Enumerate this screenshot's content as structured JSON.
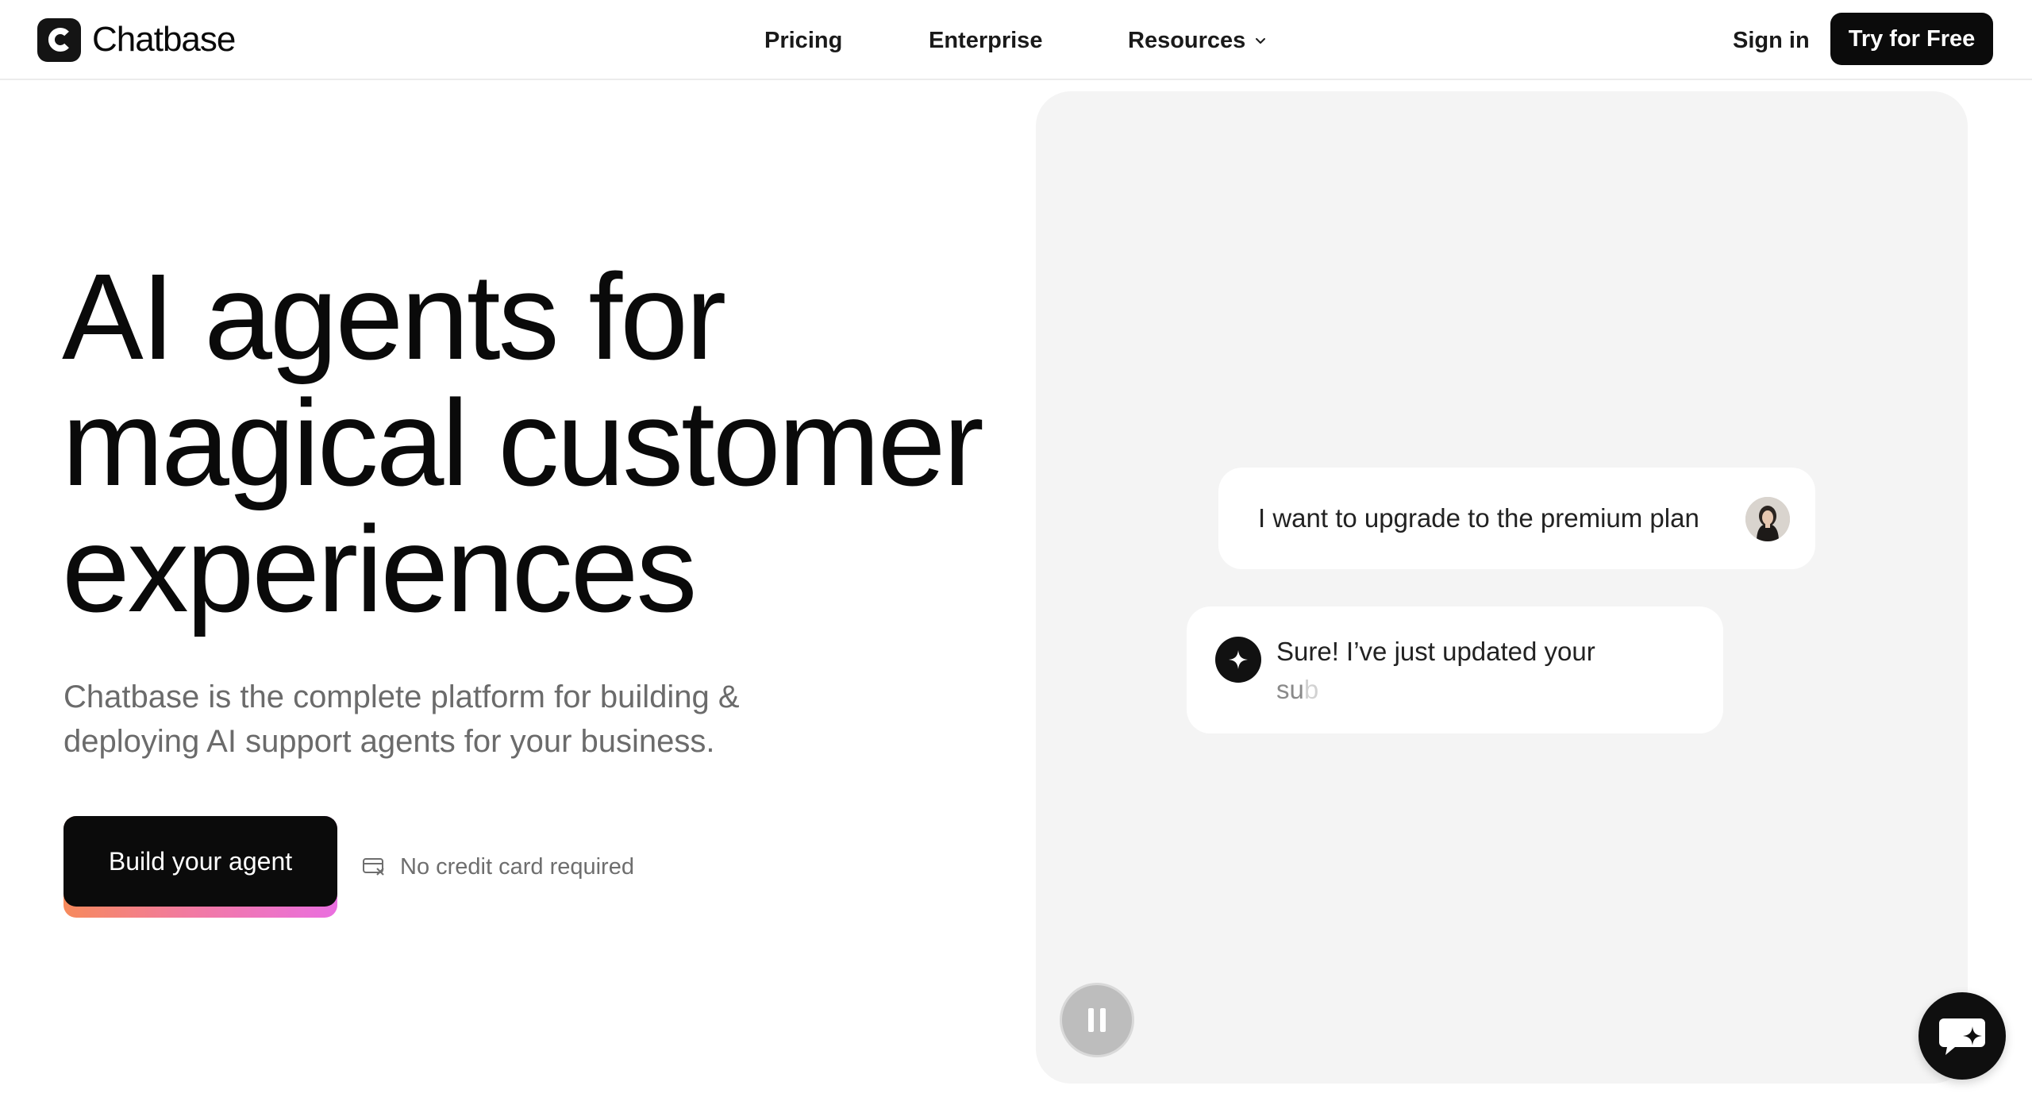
{
  "brand": {
    "name": "Chatbase",
    "logo_icon": "chatbase-c-logo"
  },
  "nav": {
    "pricing": "Pricing",
    "enterprise": "Enterprise",
    "resources": "Resources",
    "sign_in": "Sign in",
    "try_free": "Try for Free"
  },
  "hero": {
    "title_lines": [
      "AI agents for",
      "magical customer",
      "experiences"
    ],
    "subtitle": "Chatbase is the complete platform for building & deploying AI support agents for your business.",
    "cta": "Build your agent",
    "no_card": "No credit card required"
  },
  "demo": {
    "user_message": "I want to upgrade to the premium plan",
    "bot_message_line1": "Sure! I’ve just updated your",
    "bot_message_typed": "su",
    "bot_message_fading": "b",
    "pause_icon": "pause-icon"
  },
  "colors": {
    "primary_dark": "#0b0b0b",
    "panel_bg": "#f4f4f4",
    "muted_text": "#6b6b6b",
    "cta_gradient": [
      "#f68a5c",
      "#f27aa0",
      "#ea6fe0"
    ]
  }
}
